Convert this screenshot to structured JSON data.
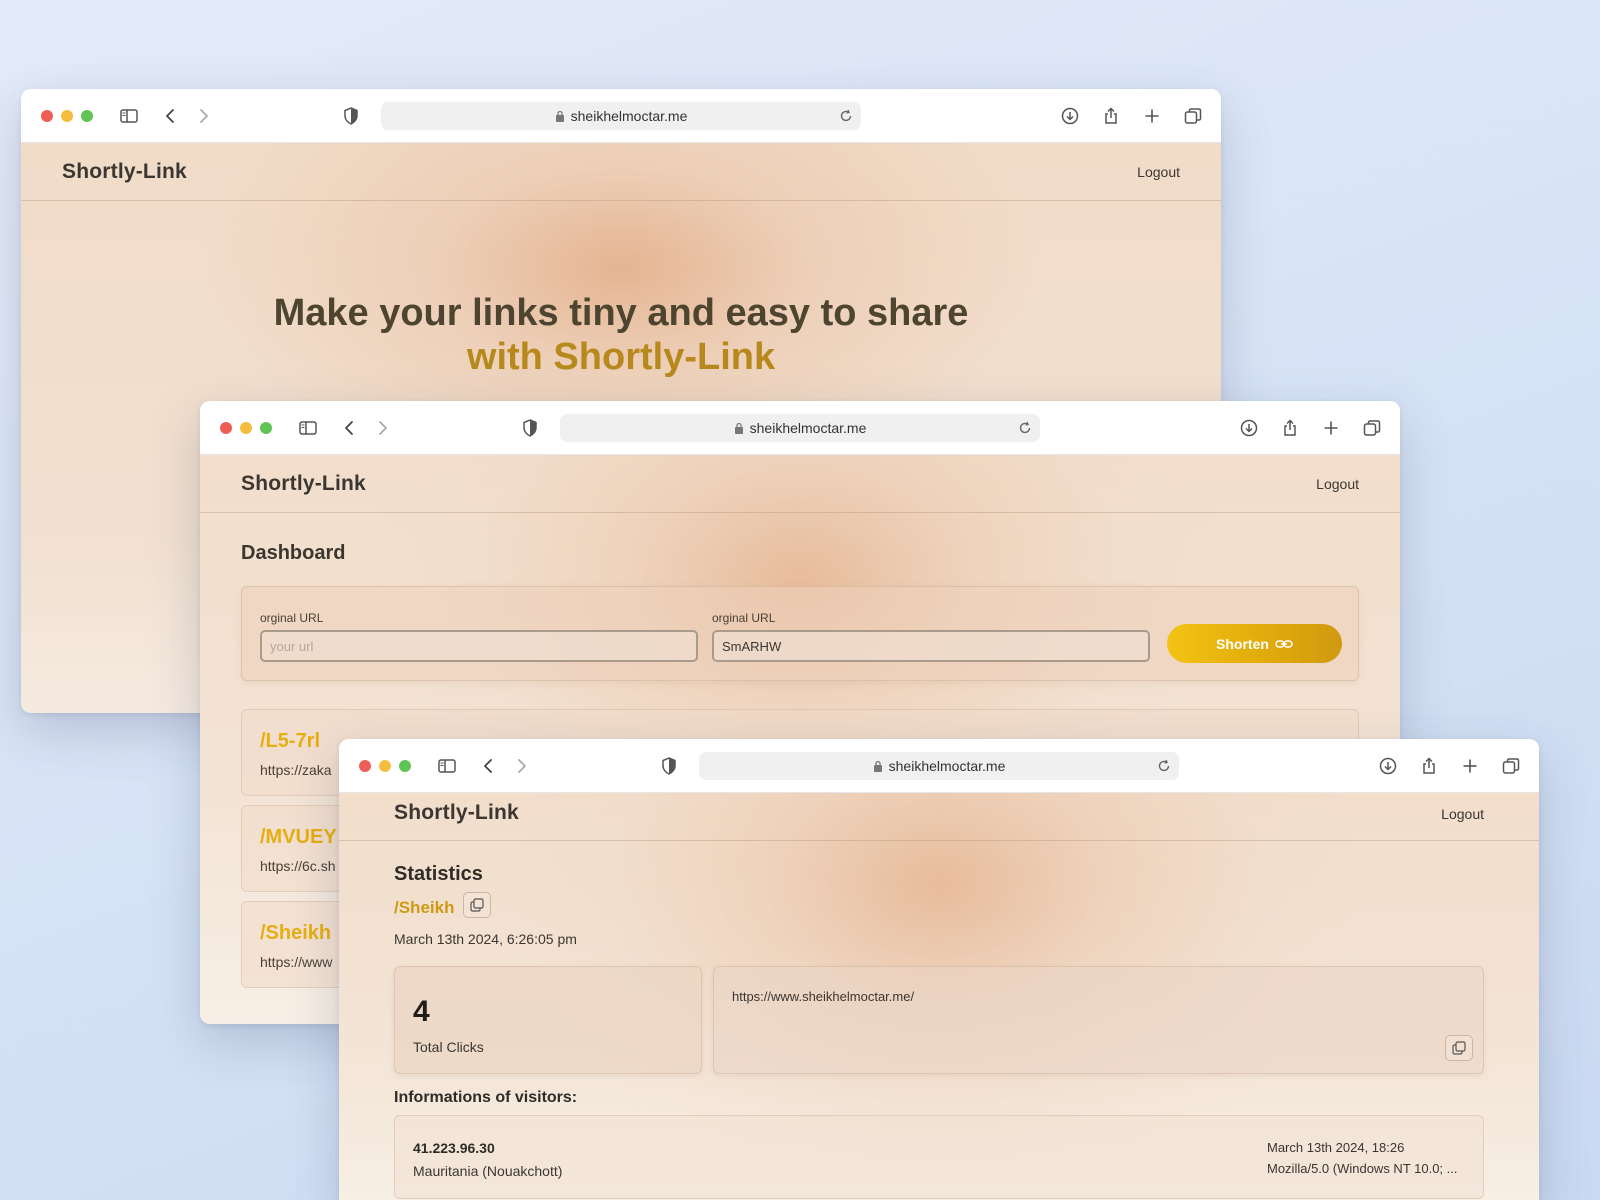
{
  "browser": {
    "address": "sheikhelmoctar.me"
  },
  "site": {
    "brand": "Shortly-Link",
    "logout": "Logout"
  },
  "landing": {
    "headline_line1": "Make your links tiny and easy to share",
    "headline_line2": "with Shortly-Link"
  },
  "dashboard": {
    "title": "Dashboard",
    "original_label": "orginal URL",
    "original_placeholder": "your url",
    "alias_label": "orginal URL",
    "alias_value": "SmARHW",
    "shorten_label": "Shorten",
    "links": [
      {
        "slug": "/L5-7rl",
        "url": "https://zaka"
      },
      {
        "slug": "/MVUEY",
        "url": "https://6c.sh"
      },
      {
        "slug": "/Sheikh",
        "url": "https://www"
      }
    ]
  },
  "statistics": {
    "title": "Statistics",
    "slug": "/Sheikh",
    "created": "March 13th 2024, 6:26:05 pm",
    "total_clicks": "4",
    "total_clicks_label": "Total Clicks",
    "original_url": "https://www.sheikhelmoctar.me/",
    "visitors_title": "Informations of visitors:",
    "visitors": [
      {
        "ip": "41.223.96.30",
        "location": "Mauritania (Nouakchott)",
        "time": "March 13th 2024, 18:26",
        "user_agent": "Mozilla/5.0 (Windows NT 10.0; ..."
      }
    ]
  },
  "colors": {
    "accent": "#e7ae12",
    "accent_dark": "#b7891c"
  },
  "icons": {
    "sidebar": "sidebar-icon",
    "back": "chevron-left-icon",
    "forward": "chevron-right-icon",
    "privacy": "shield-icon",
    "lock": "lock-icon",
    "reload": "reload-icon",
    "download": "download-icon",
    "share": "share-icon",
    "new_tab": "plus-icon",
    "tabs": "tabs-overview-icon",
    "link": "link-icon",
    "copy": "copy-icon"
  }
}
